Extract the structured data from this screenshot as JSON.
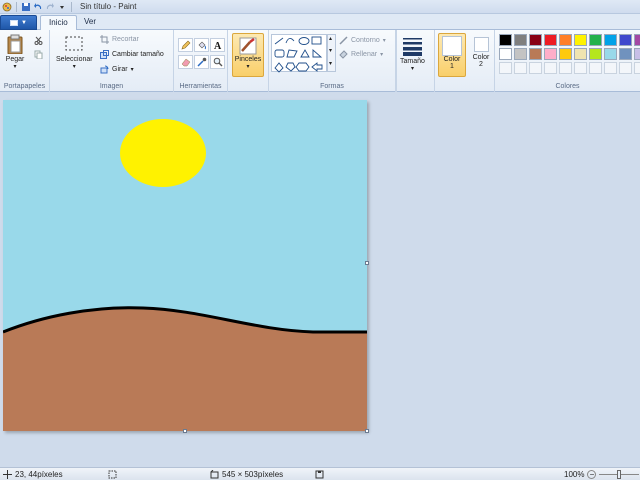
{
  "app": {
    "title": "Sin título - Paint"
  },
  "tabs": [
    {
      "label": "Inicio"
    },
    {
      "label": "Ver"
    }
  ],
  "ribbon": {
    "portapapeles": {
      "label": "Portapapeles",
      "paste": "Pegar"
    },
    "imagen": {
      "label": "Imagen",
      "select": "Seleccionar",
      "crop": "Recortar",
      "resize": "Cambiar tamaño",
      "rotate": "Girar"
    },
    "herramientas": {
      "label": "Herramientas"
    },
    "pinceles": {
      "label": "Pinceles"
    },
    "formas": {
      "label": "Formas",
      "outline": "Contorno",
      "fill": "Rellenar"
    },
    "tamano": {
      "label": "Tamaño"
    },
    "color1": {
      "label": "Color",
      "num": "1"
    },
    "color2": {
      "label": "Color",
      "num": "2"
    },
    "colores": {
      "label": "Colores"
    }
  },
  "palette_row1": [
    "#000000",
    "#7f7f7f",
    "#880015",
    "#ed1c24",
    "#ff7f27",
    "#fff200",
    "#22b14c",
    "#00a2e8",
    "#3f48cc",
    "#a349a4"
  ],
  "palette_row2": [
    "#ffffff",
    "#c3c3c3",
    "#b97a57",
    "#ffaec9",
    "#ffc90e",
    "#efe4b0",
    "#b5e61d",
    "#99d9ea",
    "#7092be",
    "#c8bfe7"
  ],
  "colors": {
    "color1": "#ffffff",
    "color2": "#ffffff",
    "sky": "#99d9ea",
    "sun": "#fff200",
    "ground": "#b97a57",
    "line": "#000000"
  },
  "status": {
    "cursor": "23, 44píxeles",
    "size": "545 × 503píxeles",
    "zoom": "100%"
  }
}
